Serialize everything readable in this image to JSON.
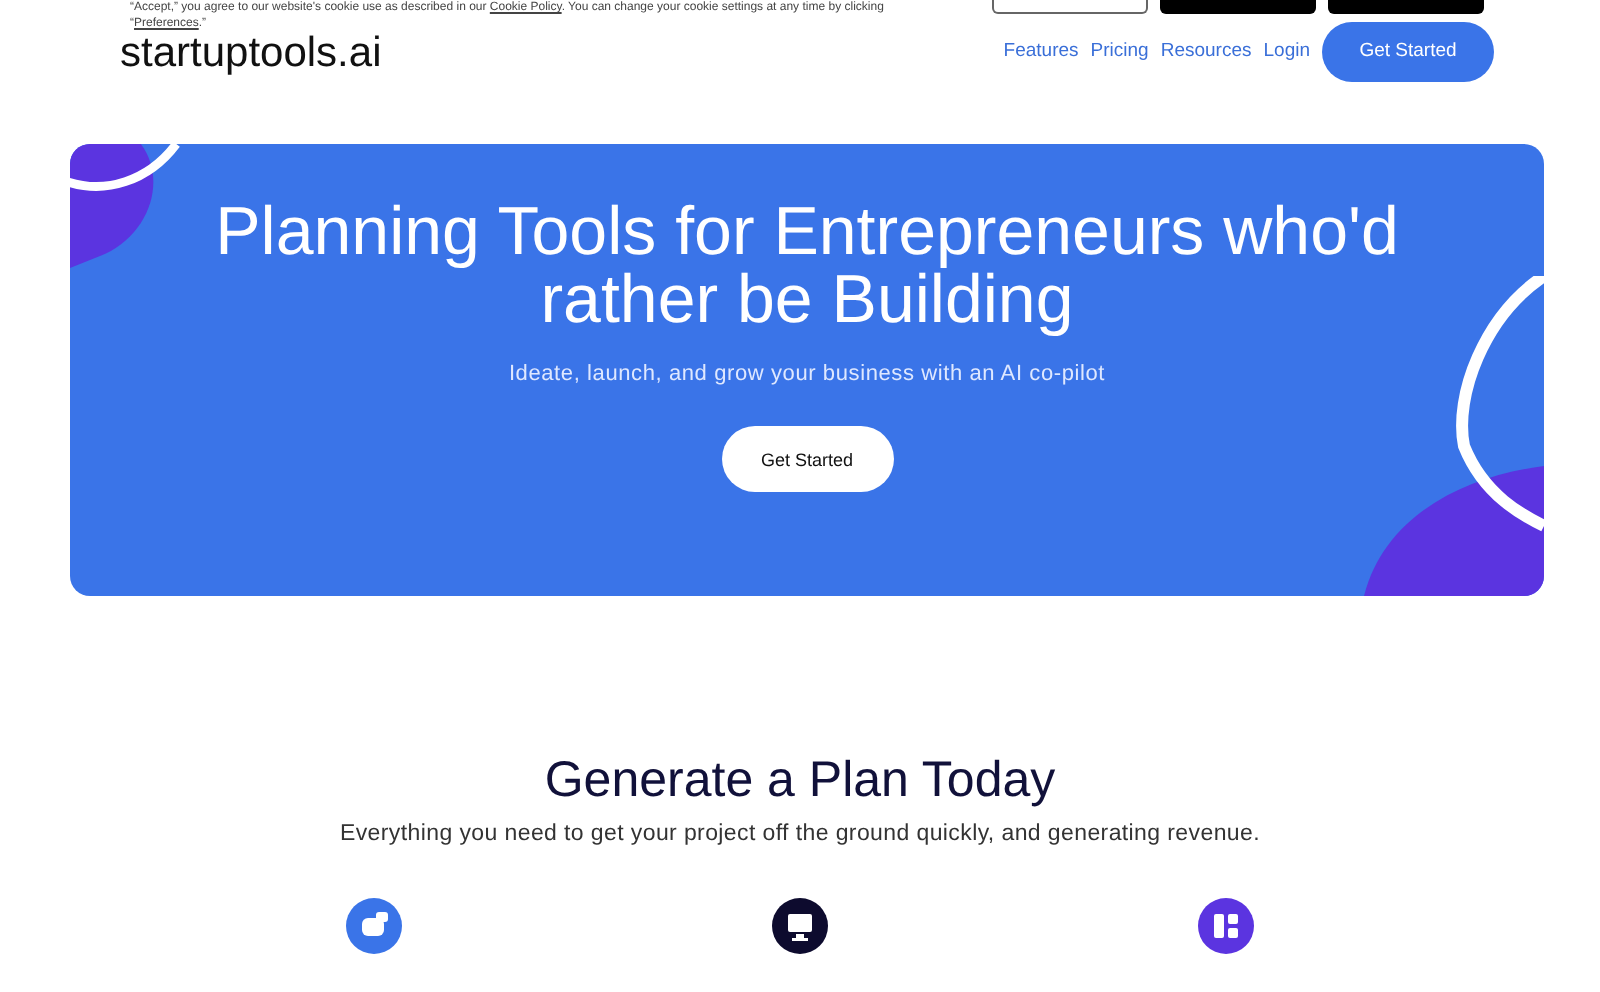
{
  "cookie_banner": {
    "text": "“Accept,” you agree to our website's cookie use as described in our ",
    "link": "Cookie Policy",
    "text_after": ". You can change your cookie settings at any time by clicking",
    "quote_open": "“",
    "preferences_link": "Preferences",
    "text_end": ".”",
    "buttons": [
      {
        "kind": "outline"
      },
      {
        "kind": "solid"
      },
      {
        "kind": "solid"
      }
    ]
  },
  "header": {
    "logo": "startuptools.ai",
    "nav": [
      "Features",
      "Pricing",
      "Resources",
      "Login"
    ],
    "cta": "Get Started"
  },
  "hero": {
    "title": "Planning Tools for Entrepreneurs who'd rather be Building",
    "subtitle": "Ideate, launch, and grow your business with an AI co-pilot",
    "button": "Get Started"
  },
  "section": {
    "title": "Generate a Plan Today",
    "subtitle": "Everything you need to get your project off the ground quickly, and generating revenue.",
    "features": [
      {
        "kind": "chat",
        "color": "#3a74e8"
      },
      {
        "kind": "monitor",
        "color": "#0d0b2e"
      },
      {
        "kind": "grid",
        "color": "#5b34e0"
      }
    ]
  }
}
